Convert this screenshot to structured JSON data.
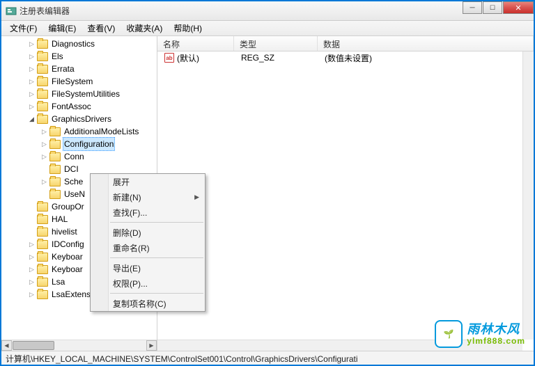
{
  "window": {
    "title": "注册表编辑器"
  },
  "menubar": {
    "file": "文件(F)",
    "edit": "编辑(E)",
    "view": "查看(V)",
    "favorites": "收藏夹(A)",
    "help": "帮助(H)"
  },
  "tree": {
    "items": [
      {
        "label": "Diagnostics",
        "depth": 2,
        "toggle": "collapsed"
      },
      {
        "label": "Els",
        "depth": 2,
        "toggle": "collapsed"
      },
      {
        "label": "Errata",
        "depth": 2,
        "toggle": "collapsed"
      },
      {
        "label": "FileSystem",
        "depth": 2,
        "toggle": "collapsed"
      },
      {
        "label": "FileSystemUtilities",
        "depth": 2,
        "toggle": "collapsed"
      },
      {
        "label": "FontAssoc",
        "depth": 2,
        "toggle": "collapsed"
      },
      {
        "label": "GraphicsDrivers",
        "depth": 2,
        "toggle": "expanded"
      },
      {
        "label": "AdditionalModeLists",
        "depth": 3,
        "toggle": "collapsed"
      },
      {
        "label": "Configuration",
        "depth": 3,
        "toggle": "collapsed",
        "selected": true
      },
      {
        "label": "Conn",
        "depth": 3,
        "toggle": "collapsed"
      },
      {
        "label": "DCI",
        "depth": 3,
        "toggle": "none"
      },
      {
        "label": "Sche",
        "depth": 3,
        "toggle": "collapsed"
      },
      {
        "label": "UseN",
        "depth": 3,
        "toggle": "none"
      },
      {
        "label": "GroupOr",
        "depth": 2,
        "toggle": "none"
      },
      {
        "label": "HAL",
        "depth": 2,
        "toggle": "none"
      },
      {
        "label": "hivelist",
        "depth": 2,
        "toggle": "none"
      },
      {
        "label": "IDConfig",
        "depth": 2,
        "toggle": "collapsed"
      },
      {
        "label": "Keyboar",
        "depth": 2,
        "toggle": "collapsed"
      },
      {
        "label": "Keyboar",
        "depth": 2,
        "toggle": "collapsed"
      },
      {
        "label": "Lsa",
        "depth": 2,
        "toggle": "collapsed"
      },
      {
        "label": "LsaExtensionConfig",
        "depth": 2,
        "toggle": "collapsed"
      }
    ]
  },
  "list": {
    "headers": {
      "name": "名称",
      "type": "类型",
      "data": "数据"
    },
    "rows": [
      {
        "name": "(默认)",
        "type": "REG_SZ",
        "data": "(数值未设置)"
      }
    ]
  },
  "contextMenu": {
    "expand": "展开",
    "new": "新建(N)",
    "find": "查找(F)...",
    "delete": "删除(D)",
    "rename": "重命名(R)",
    "export": "导出(E)",
    "permissions": "权限(P)...",
    "copyKeyName": "复制项名称(C)"
  },
  "statusbar": {
    "path": "计算机\\HKEY_LOCAL_MACHINE\\SYSTEM\\ControlSet001\\Control\\GraphicsDrivers\\Configurati"
  },
  "watermark": {
    "brand": "雨林木风",
    "url": "ylmf888.com",
    "emoji": "🌱"
  }
}
